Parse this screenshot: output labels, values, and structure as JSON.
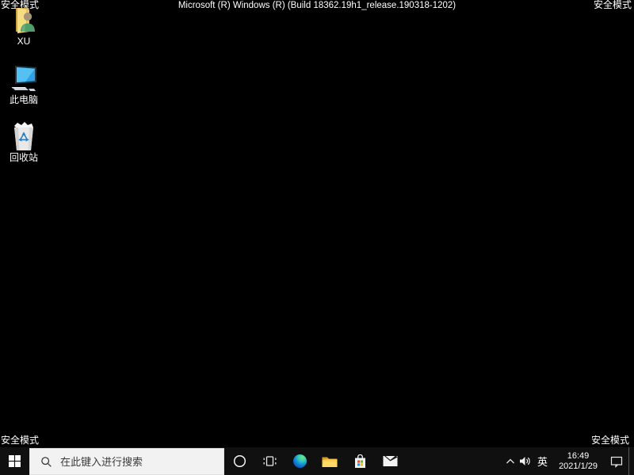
{
  "system": {
    "safe_mode_label": "安全模式",
    "build_banner": "Microsoft (R) Windows (R) (Build 18362.19h1_release.190318-1202)"
  },
  "desktop": {
    "icons": [
      {
        "id": "user-files-folder",
        "label": "XU"
      },
      {
        "id": "this-pc",
        "label": "此电脑"
      },
      {
        "id": "recycle-bin",
        "label": "回收站"
      }
    ]
  },
  "taskbar": {
    "search": {
      "placeholder": "在此键入进行搜索"
    },
    "tray": {
      "language": "英",
      "time": "16:49",
      "date": "2021/1/29"
    }
  },
  "colors": {
    "desktop_background": "#000000",
    "taskbar_background": "#101010",
    "search_box_background": "#f2f2f2",
    "search_text": "#3c3c3c",
    "corner_text": "#ffffff",
    "folder_yellow": "#fcc743",
    "edge_blue": "#0b5ac6",
    "screen_blue": "#2fa0e4",
    "store_red": "#f25022",
    "store_green": "#7fba00",
    "store_blue": "#00a4ef",
    "store_yellow": "#ffb900"
  }
}
